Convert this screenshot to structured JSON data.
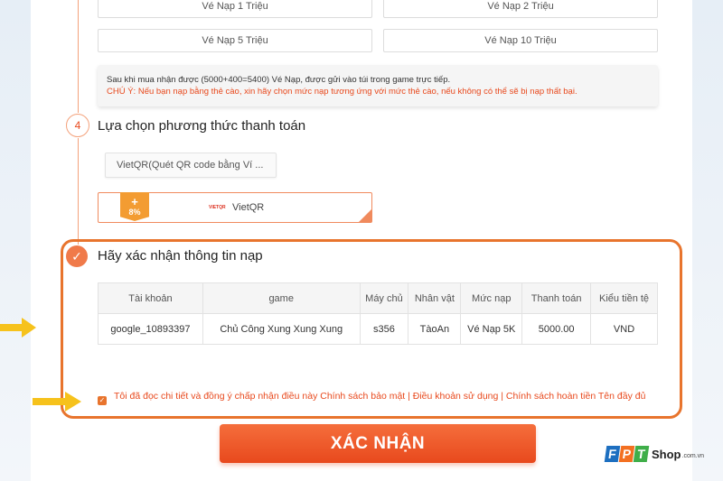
{
  "amounts": {
    "row1": [
      "Vé Nạp 1 Triệu",
      "Vé Nạp 2 Triệu"
    ],
    "row2": [
      "Vé Nạp 5 Triệu",
      "Vé Nạp 10 Triệu"
    ]
  },
  "note": {
    "line1": "Sau khi mua nhận được (5000+400=5400) Vé Nạp, được gửi vào túi trong game trực tiếp.",
    "line2": "CHÚ Ý: Nếu bạn nạp bằng thẻ cào, xin hãy chọn mức nạp tương ứng với mức thẻ cào, nếu không có thể sẽ bị nạp thất bại."
  },
  "payment_step": {
    "number": "4",
    "title": "Lựa chọn phương thức thanh toán",
    "selected_method": "VietQR(Quét QR code bằng Ví ...",
    "card": {
      "bonus_plus": "+",
      "bonus_percent": "8%",
      "logo_text": "VIETQR",
      "label": "VietQR"
    }
  },
  "confirm": {
    "check_icon": "✓",
    "title": "Hãy xác nhận thông tin nạp",
    "headers": [
      "Tài khoản",
      "game",
      "Máy chủ",
      "Nhân vật",
      "Mức nạp",
      "Thanh toán",
      "Kiểu tiền tệ"
    ],
    "row": [
      "google_10893397",
      "Chủ Công Xung Xung Xung",
      "s356",
      "TàoAn",
      "Vé Nạp 5K",
      "5000.00",
      "VND"
    ],
    "agree_text": "Tôi đã đọc chi tiết và đồng ý chấp nhận điều này Chính sách bảo mật  | Điều khoản sử dụng  | Chính sách hoàn tiền Tên đầy đủ"
  },
  "submit_label": "XÁC NHẬN",
  "watermark": {
    "letters": [
      "F",
      "P",
      "T"
    ],
    "shop": "Shop",
    "domain": ".com.vn"
  },
  "colors": {
    "accent": "#e8491d",
    "highlight": "#e8742d",
    "arrow": "#f6c21c",
    "fpt_blue": "#1d6fc0",
    "fpt_orange": "#f37021",
    "fpt_green": "#3fae49"
  }
}
